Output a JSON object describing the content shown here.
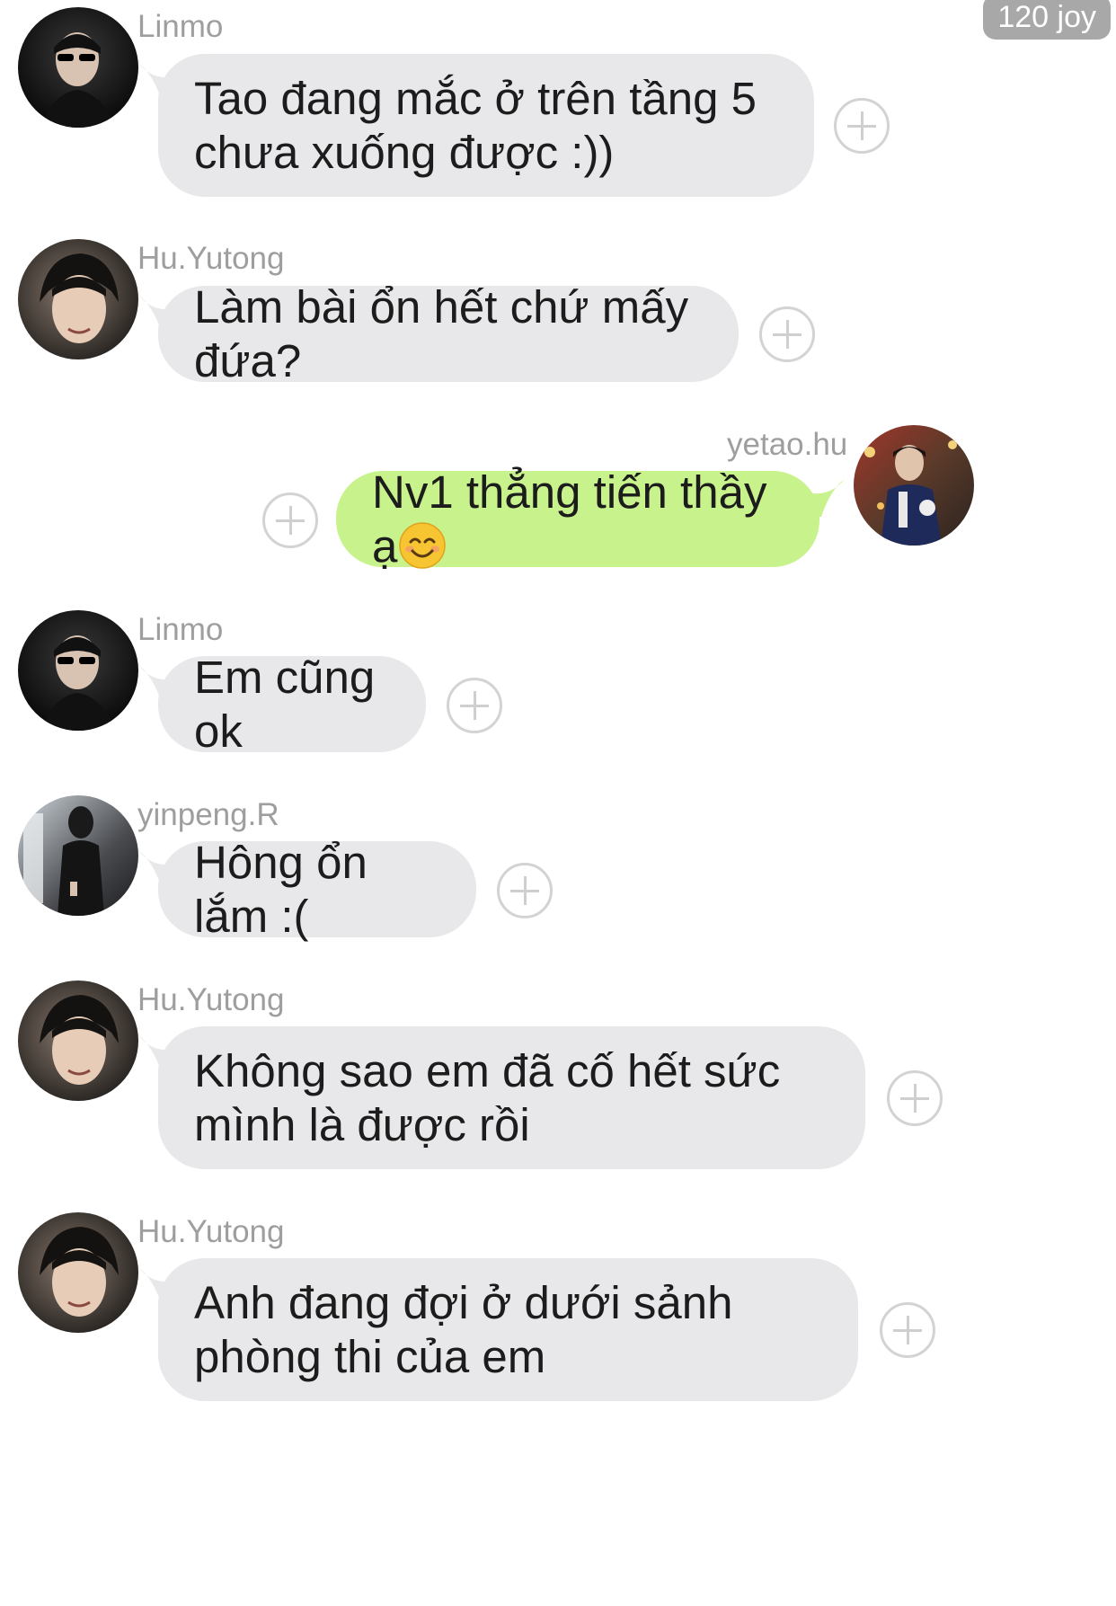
{
  "header": {
    "points_badge": "120 joy"
  },
  "messages": [
    {
      "sender": "Linmo",
      "text": "Tao đang mắc ở trên tầng 5 chưa xuống được :))",
      "side": "incoming"
    },
    {
      "sender": "Hu.Yutong",
      "text": "Làm bài ổn hết chứ mấy đứa?",
      "side": "incoming"
    },
    {
      "sender": "yetao.hu",
      "text": "Nv1 thẳng tiến thầy ạ",
      "emoji": "smiling-face-icon",
      "side": "outgoing"
    },
    {
      "sender": "Linmo",
      "text": "Em cũng ok",
      "side": "incoming"
    },
    {
      "sender": "yinpeng.R",
      "text": "Hông ổn lắm :(",
      "side": "incoming"
    },
    {
      "sender": "Hu.Yutong",
      "text": "Không sao em đã cố hết sức mình là được rồi",
      "side": "incoming"
    },
    {
      "sender": "Hu.Yutong",
      "text": "Anh đang đợi ở dưới sảnh phòng thi của em",
      "side": "incoming"
    }
  ],
  "colors": {
    "incoming_bubble": "#e8e8ea",
    "outgoing_bubble": "#c8f28c",
    "sender_name": "#9e9e9e",
    "badge": "#a8a8a8"
  }
}
